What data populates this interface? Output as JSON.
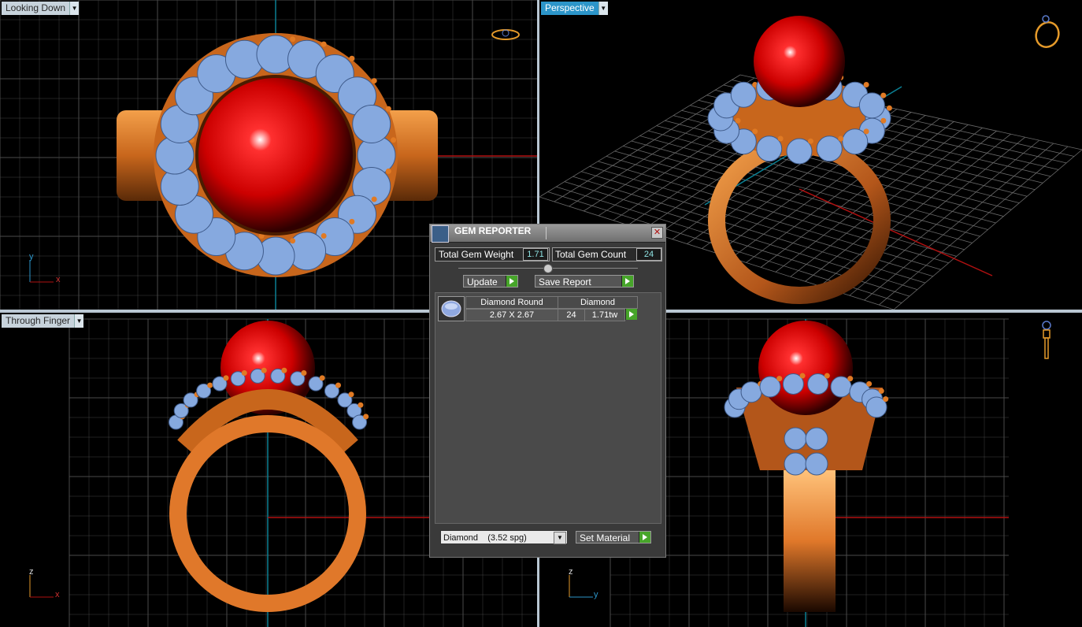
{
  "viewports": {
    "top_left": {
      "label": "Looking Down",
      "axis_v": "y",
      "axis_h": "x"
    },
    "top_right": {
      "label": "Perspective"
    },
    "bottom_left": {
      "label": "Through Finger",
      "axis_v": "z",
      "axis_h": "x"
    },
    "bottom_right": {
      "label": "",
      "axis_v": "z",
      "axis_h": "y"
    }
  },
  "colors": {
    "gold": "#d8782a",
    "ruby": "#d10000",
    "gem": "#86a9df",
    "grid": "#4a4a4a",
    "accent": "#2c95c9"
  },
  "icons": {
    "ring_top": "ring-top-view-icon",
    "ring_persp": "ring-perspective-icon",
    "ring_side": "ring-side-icon"
  },
  "gem_reporter": {
    "title": "GEM REPORTER",
    "close": "✕",
    "total_weight_label": "Total Gem Weight",
    "total_weight_value": "1.71",
    "total_count_label": "Total Gem Count",
    "total_count_value": "24",
    "update_label": "Update",
    "save_report_label": "Save Report",
    "row": {
      "shape": "Diamond Round",
      "material": "Diamond",
      "size": "2.67 X 2.67",
      "count": "24",
      "weight": "1.71tw"
    },
    "material_select": "Diamond    (3.52 spg)",
    "set_material_label": "Set Material"
  }
}
